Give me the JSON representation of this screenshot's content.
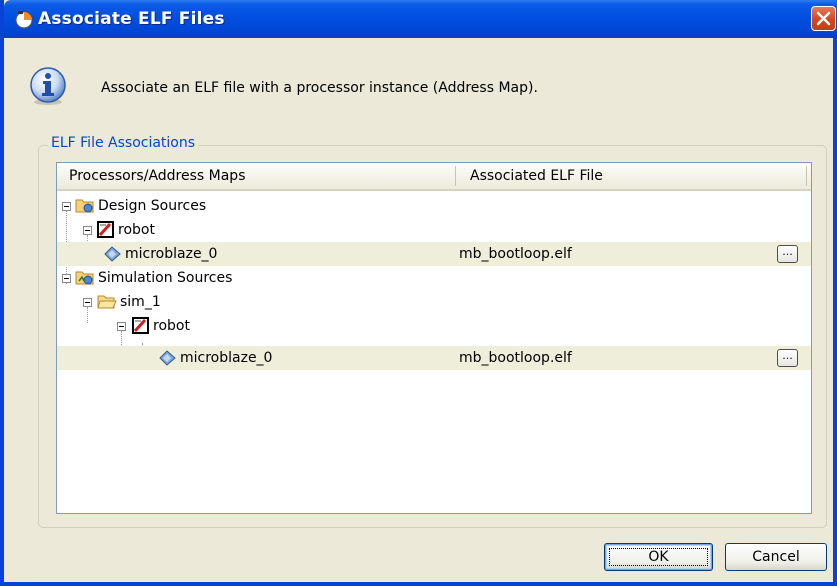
{
  "window": {
    "title": "Associate ELF Files"
  },
  "info": {
    "message": "Associate an ELF file with a processor instance (Address Map)."
  },
  "group": {
    "label": "ELF File Associations"
  },
  "table": {
    "columns": [
      "Processors/Address Maps",
      "Associated ELF File"
    ],
    "rows": [
      {
        "label": "Design Sources",
        "elf": "",
        "icon": "design-sources-folder-icon"
      },
      {
        "label": "robot",
        "elf": "",
        "icon": "block-design-icon"
      },
      {
        "label": "microblaze_0",
        "elf": "mb_bootloop.elf",
        "icon": "processor-icon",
        "browse": "..."
      },
      {
        "label": "Simulation Sources",
        "elf": "",
        "icon": "simulation-sources-folder-icon"
      },
      {
        "label": "sim_1",
        "elf": "",
        "icon": "folder-icon"
      },
      {
        "label": "robot",
        "elf": "",
        "icon": "block-design-icon"
      },
      {
        "label": "microblaze_0",
        "elf": "mb_bootloop.elf",
        "icon": "processor-icon",
        "browse": "..."
      }
    ]
  },
  "buttons": {
    "ok": "OK",
    "cancel": "Cancel"
  },
  "colors": {
    "titlebar": "#0a5be6",
    "group_label": "#0046d5",
    "alt_row": "#efeeda",
    "close": "#d4461e"
  }
}
